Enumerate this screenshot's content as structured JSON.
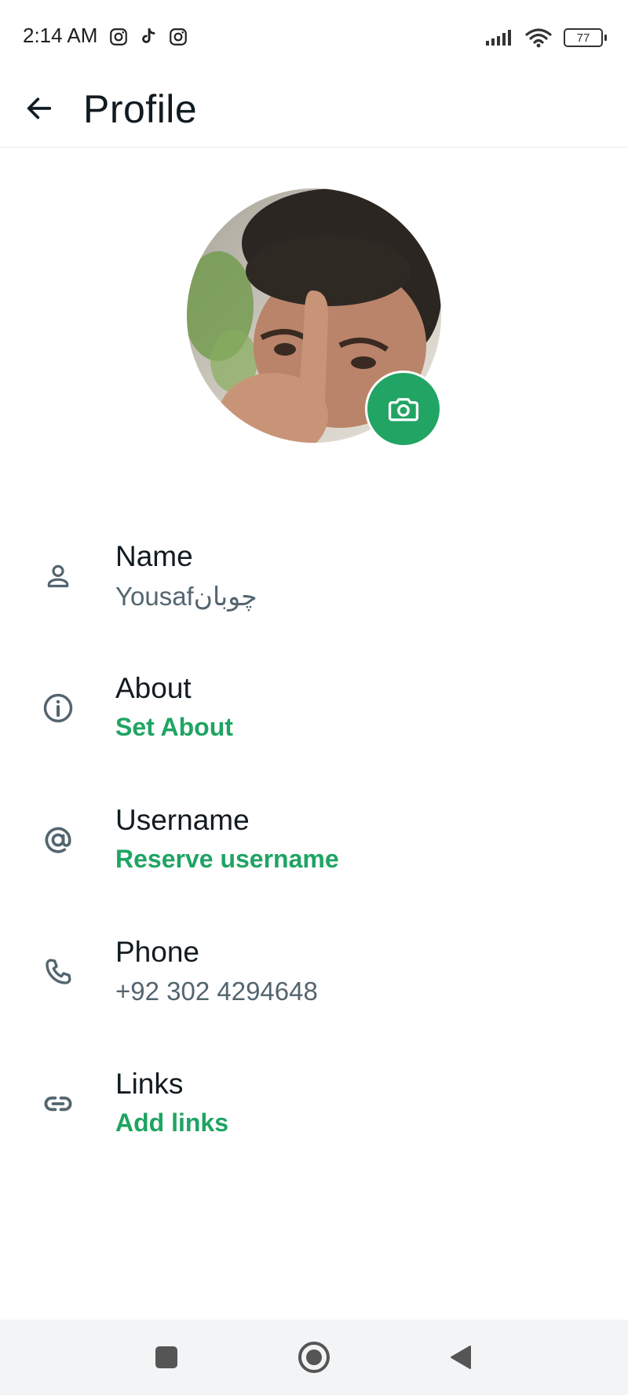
{
  "status_bar": {
    "time": "2:14 AM",
    "app_icons": [
      "instagram-icon",
      "tiktok-icon",
      "instagram-icon"
    ],
    "battery": "77",
    "system_icons": [
      "signal-icon",
      "wifi-icon",
      "battery-icon"
    ]
  },
  "app_bar": {
    "back_icon": "arrow-left-icon",
    "title": "Profile"
  },
  "avatar": {
    "edit_icon": "camera-icon",
    "accent_color": "#21a464"
  },
  "rows": [
    {
      "icon": "person-icon",
      "title": "Name",
      "value": "Yousafچوبان"
    },
    {
      "icon": "info-icon",
      "title": "About",
      "value": "Set About"
    },
    {
      "icon": "at-icon",
      "title": "Username",
      "value": "Reserve username"
    },
    {
      "icon": "phone-icon",
      "title": "Phone",
      "value": "+92 302 4294648"
    },
    {
      "icon": "link-icon",
      "title": "Links",
      "value": "Add links"
    }
  ],
  "nav_bar": {
    "buttons": [
      "recents-square-icon",
      "home-circle-icon",
      "back-triangle-icon"
    ]
  },
  "colors": {
    "accent": "#1fa463",
    "primary_text": "#111b21",
    "secondary_text": "#54656f"
  }
}
